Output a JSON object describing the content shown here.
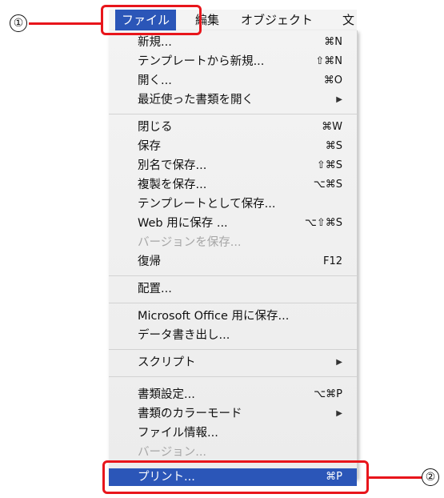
{
  "menubar": {
    "items": [
      {
        "label": "ファイル",
        "active": true
      },
      {
        "label": "編集"
      },
      {
        "label": "オブジェクト"
      },
      {
        "label": "文"
      }
    ]
  },
  "menu": {
    "items": [
      {
        "label": "新規...",
        "shortcut": "⌘N"
      },
      {
        "label": "テンプレートから新規...",
        "shortcut": "⇧⌘N"
      },
      {
        "label": "開く...",
        "shortcut": "⌘O"
      },
      {
        "label": "最近使った書類を開く",
        "submenu": "▶"
      },
      {
        "label": "閉じる",
        "shortcut": "⌘W"
      },
      {
        "label": "保存",
        "shortcut": "⌘S"
      },
      {
        "label": "別名で保存...",
        "shortcut": "⇧⌘S"
      },
      {
        "label": "複製を保存...",
        "shortcut": "⌥⌘S"
      },
      {
        "label": "テンプレートとして保存..."
      },
      {
        "label": "Web 用に保存 ...",
        "shortcut": "⌥⇧⌘S"
      },
      {
        "label": "バージョンを保存...",
        "disabled": true
      },
      {
        "label": "復帰",
        "shortcut": "F12"
      },
      {
        "label": "配置..."
      },
      {
        "label": "Microsoft Office 用に保存..."
      },
      {
        "label": "データ書き出し..."
      },
      {
        "label": "スクリプト",
        "submenu": "▶"
      },
      {
        "label": "書類設定...",
        "shortcut": "⌥⌘P"
      },
      {
        "label": "書類のカラーモード",
        "submenu": "▶"
      },
      {
        "label": "ファイル情報..."
      },
      {
        "label": "バージョン...",
        "disabled": true
      },
      {
        "label": "プリント...",
        "shortcut": "⌘P",
        "highlighted": true
      }
    ]
  },
  "callouts": [
    {
      "number": "①"
    },
    {
      "number": "②"
    }
  ],
  "colors": {
    "accent": "#2b56b8",
    "callout": "#e8151b",
    "disabled_text": "#a6a6a6"
  }
}
